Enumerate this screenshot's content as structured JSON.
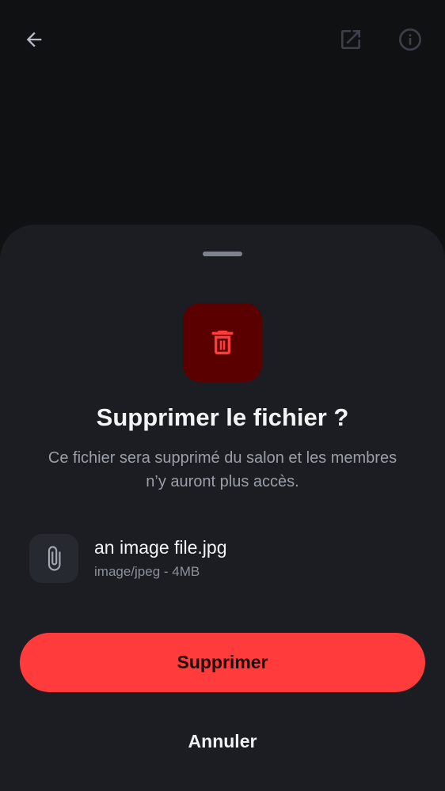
{
  "topbar": {
    "back_icon": "arrow-left-icon",
    "open_icon": "open-external-icon",
    "info_icon": "info-icon"
  },
  "sheet": {
    "title": "Supprimer le fichier ?",
    "description": "Ce fichier sera supprimé du salon et les membres n’y auront plus accès.",
    "danger_icon": "trash-icon",
    "file": {
      "icon": "paperclip-icon",
      "name": "an image file.jpg",
      "meta": "image/jpeg - 4MB"
    },
    "primary_label": "Supprimer",
    "secondary_label": "Annuler"
  },
  "colors": {
    "sheet_bg": "#1b1d22",
    "danger": "#ff3b3b",
    "danger_bg": "#5a0000"
  }
}
